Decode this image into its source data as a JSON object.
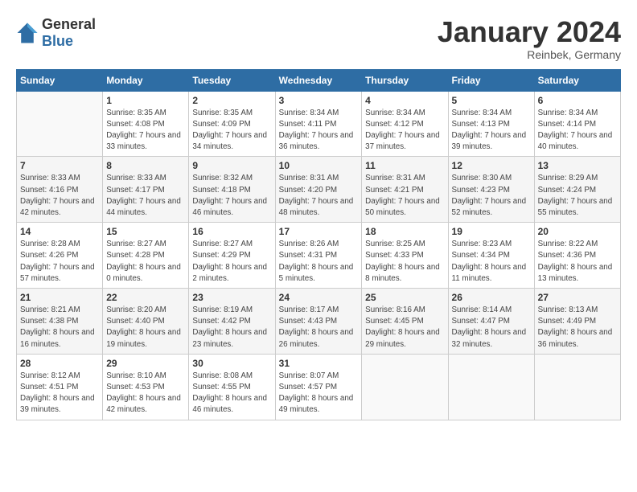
{
  "header": {
    "logo": {
      "general": "General",
      "blue": "Blue"
    },
    "title": "January 2024",
    "subtitle": "Reinbek, Germany"
  },
  "days_of_week": [
    "Sunday",
    "Monday",
    "Tuesday",
    "Wednesday",
    "Thursday",
    "Friday",
    "Saturday"
  ],
  "weeks": [
    [
      {
        "day": "",
        "sunrise": "",
        "sunset": "",
        "daylight": ""
      },
      {
        "day": "1",
        "sunrise": "8:35 AM",
        "sunset": "4:08 PM",
        "daylight": "7 hours and 33 minutes."
      },
      {
        "day": "2",
        "sunrise": "8:35 AM",
        "sunset": "4:09 PM",
        "daylight": "7 hours and 34 minutes."
      },
      {
        "day": "3",
        "sunrise": "8:34 AM",
        "sunset": "4:11 PM",
        "daylight": "7 hours and 36 minutes."
      },
      {
        "day": "4",
        "sunrise": "8:34 AM",
        "sunset": "4:12 PM",
        "daylight": "7 hours and 37 minutes."
      },
      {
        "day": "5",
        "sunrise": "8:34 AM",
        "sunset": "4:13 PM",
        "daylight": "7 hours and 39 minutes."
      },
      {
        "day": "6",
        "sunrise": "8:34 AM",
        "sunset": "4:14 PM",
        "daylight": "7 hours and 40 minutes."
      }
    ],
    [
      {
        "day": "7",
        "sunrise": "8:33 AM",
        "sunset": "4:16 PM",
        "daylight": "7 hours and 42 minutes."
      },
      {
        "day": "8",
        "sunrise": "8:33 AM",
        "sunset": "4:17 PM",
        "daylight": "7 hours and 44 minutes."
      },
      {
        "day": "9",
        "sunrise": "8:32 AM",
        "sunset": "4:18 PM",
        "daylight": "7 hours and 46 minutes."
      },
      {
        "day": "10",
        "sunrise": "8:31 AM",
        "sunset": "4:20 PM",
        "daylight": "7 hours and 48 minutes."
      },
      {
        "day": "11",
        "sunrise": "8:31 AM",
        "sunset": "4:21 PM",
        "daylight": "7 hours and 50 minutes."
      },
      {
        "day": "12",
        "sunrise": "8:30 AM",
        "sunset": "4:23 PM",
        "daylight": "7 hours and 52 minutes."
      },
      {
        "day": "13",
        "sunrise": "8:29 AM",
        "sunset": "4:24 PM",
        "daylight": "7 hours and 55 minutes."
      }
    ],
    [
      {
        "day": "14",
        "sunrise": "8:28 AM",
        "sunset": "4:26 PM",
        "daylight": "7 hours and 57 minutes."
      },
      {
        "day": "15",
        "sunrise": "8:27 AM",
        "sunset": "4:28 PM",
        "daylight": "8 hours and 0 minutes."
      },
      {
        "day": "16",
        "sunrise": "8:27 AM",
        "sunset": "4:29 PM",
        "daylight": "8 hours and 2 minutes."
      },
      {
        "day": "17",
        "sunrise": "8:26 AM",
        "sunset": "4:31 PM",
        "daylight": "8 hours and 5 minutes."
      },
      {
        "day": "18",
        "sunrise": "8:25 AM",
        "sunset": "4:33 PM",
        "daylight": "8 hours and 8 minutes."
      },
      {
        "day": "19",
        "sunrise": "8:23 AM",
        "sunset": "4:34 PM",
        "daylight": "8 hours and 11 minutes."
      },
      {
        "day": "20",
        "sunrise": "8:22 AM",
        "sunset": "4:36 PM",
        "daylight": "8 hours and 13 minutes."
      }
    ],
    [
      {
        "day": "21",
        "sunrise": "8:21 AM",
        "sunset": "4:38 PM",
        "daylight": "8 hours and 16 minutes."
      },
      {
        "day": "22",
        "sunrise": "8:20 AM",
        "sunset": "4:40 PM",
        "daylight": "8 hours and 19 minutes."
      },
      {
        "day": "23",
        "sunrise": "8:19 AM",
        "sunset": "4:42 PM",
        "daylight": "8 hours and 23 minutes."
      },
      {
        "day": "24",
        "sunrise": "8:17 AM",
        "sunset": "4:43 PM",
        "daylight": "8 hours and 26 minutes."
      },
      {
        "day": "25",
        "sunrise": "8:16 AM",
        "sunset": "4:45 PM",
        "daylight": "8 hours and 29 minutes."
      },
      {
        "day": "26",
        "sunrise": "8:14 AM",
        "sunset": "4:47 PM",
        "daylight": "8 hours and 32 minutes."
      },
      {
        "day": "27",
        "sunrise": "8:13 AM",
        "sunset": "4:49 PM",
        "daylight": "8 hours and 36 minutes."
      }
    ],
    [
      {
        "day": "28",
        "sunrise": "8:12 AM",
        "sunset": "4:51 PM",
        "daylight": "8 hours and 39 minutes."
      },
      {
        "day": "29",
        "sunrise": "8:10 AM",
        "sunset": "4:53 PM",
        "daylight": "8 hours and 42 minutes."
      },
      {
        "day": "30",
        "sunrise": "8:08 AM",
        "sunset": "4:55 PM",
        "daylight": "8 hours and 46 minutes."
      },
      {
        "day": "31",
        "sunrise": "8:07 AM",
        "sunset": "4:57 PM",
        "daylight": "8 hours and 49 minutes."
      },
      {
        "day": "",
        "sunrise": "",
        "sunset": "",
        "daylight": ""
      },
      {
        "day": "",
        "sunrise": "",
        "sunset": "",
        "daylight": ""
      },
      {
        "day": "",
        "sunrise": "",
        "sunset": "",
        "daylight": ""
      }
    ]
  ],
  "labels": {
    "sunrise_prefix": "Sunrise: ",
    "sunset_prefix": "Sunset: ",
    "daylight_prefix": "Daylight: "
  }
}
